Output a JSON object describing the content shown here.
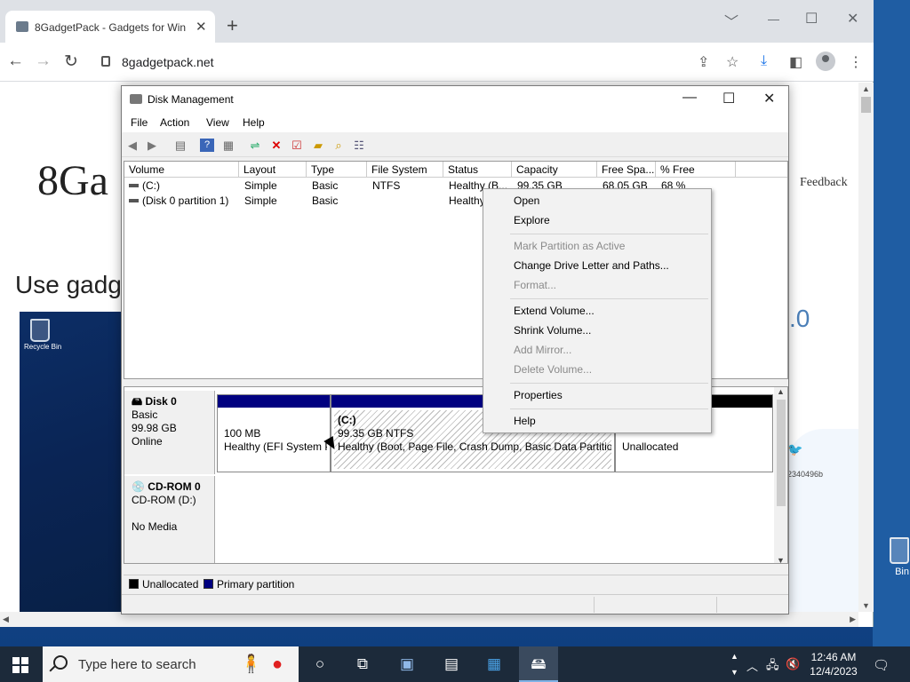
{
  "browser": {
    "tab_title": "8GadgetPack - Gadgets for Win",
    "tab_close": "✕",
    "new_tab": "+",
    "url": "8gadgetpack.net",
    "win_min": "﹀",
    "win_restore": "☐",
    "win_close": "✕"
  },
  "page": {
    "heading": "8Ga",
    "subheading": "Use gadg",
    "feedback": "Feedback",
    "version_fragment": ".0",
    "hash_fragment": "2340496b",
    "screenshot_recycle_label": "Recycle Bin"
  },
  "desktop": {
    "recycle_label": "Bin"
  },
  "disk_mgmt": {
    "title": "Disk Management",
    "menu": [
      "File",
      "Action",
      "View",
      "Help"
    ],
    "columns": [
      "Volume",
      "Layout",
      "Type",
      "File System",
      "Status",
      "Capacity",
      "Free Spa...",
      "% Free"
    ],
    "rows": [
      [
        "(C:)",
        "Simple",
        "Basic",
        "NTFS",
        "Healthy (B...",
        "99.35 GB",
        "68.05 GB",
        "68 %"
      ],
      [
        "(Disk 0 partition 1)",
        "Simple",
        "Basic",
        "",
        "Healthy",
        "",
        "",
        ""
      ]
    ],
    "disk0": {
      "name": "Disk 0",
      "type": "Basic",
      "size": "99.98 GB",
      "state": "Online",
      "part1_size": "100 MB",
      "part1_status": "Healthy (EFI System P",
      "part2_name": "(C:)",
      "part2_size": "99.35 GB NTFS",
      "part2_status": "Healthy (Boot, Page File, Crash Dump, Basic Data Partition",
      "part3_status": "Unallocated"
    },
    "cdrom": {
      "name": "CD-ROM 0",
      "drive": "CD-ROM (D:)",
      "media": "No Media"
    },
    "legend": [
      "Unallocated",
      "Primary partition"
    ],
    "colors": {
      "primary": "#000080",
      "unallocated": "#000000"
    }
  },
  "context_menu": {
    "items": [
      {
        "label": "Open",
        "enabled": true
      },
      {
        "label": "Explore",
        "enabled": true
      },
      {
        "label": "Mark Partition as Active",
        "enabled": false
      },
      {
        "label": "Change Drive Letter and Paths...",
        "enabled": true
      },
      {
        "label": "Format...",
        "enabled": false
      },
      {
        "label": "Extend Volume...",
        "enabled": true
      },
      {
        "label": "Shrink Volume...",
        "enabled": true
      },
      {
        "label": "Add Mirror...",
        "enabled": false
      },
      {
        "label": "Delete Volume...",
        "enabled": false
      },
      {
        "label": "Properties",
        "enabled": true
      },
      {
        "label": "Help",
        "enabled": true
      }
    ]
  },
  "taskbar": {
    "search_placeholder": "Type here to search",
    "time": "12:46 AM",
    "date": "12/4/2023"
  }
}
